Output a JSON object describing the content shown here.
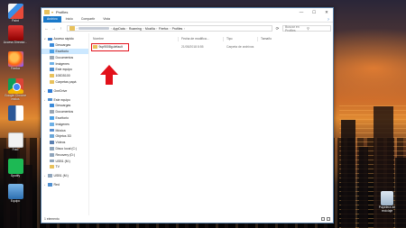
{
  "desktop": {
    "icons": [
      {
        "label": "Paint",
        "icon": "paint-icon"
      },
      {
        "label": "Access Director...",
        "icon": "access-icon"
      },
      {
        "label": "Firefox",
        "icon": "firefox-icon"
      },
      {
        "label": "Google Chrome realos",
        "icon": "chrome-icon"
      },
      {
        "label": "",
        "icon": "word-icon"
      },
      {
        "label": "Foto",
        "icon": "document-icon"
      },
      {
        "label": "Foto pagina",
        "icon": "document-icon"
      },
      {
        "label": "Spotify",
        "icon": "spotify-icon"
      },
      {
        "label": "Equipo",
        "icon": "this-pc-icon"
      },
      {
        "label": "Dispositivo",
        "icon": "device-icon"
      },
      {
        "label": "Papelera de reciclaje",
        "icon": "recycle-bin-icon"
      }
    ]
  },
  "window": {
    "title": "Profiles",
    "ribbon_tabs": [
      "Archivo",
      "Inicio",
      "Compartir",
      "Vista"
    ],
    "address": {
      "crumbs": [
        "AppData",
        "Roaming",
        "Mozilla",
        "Firefox",
        "Profiles"
      ]
    },
    "search_placeholder": "Buscar en Profiles",
    "nav": {
      "quick_access": "Acceso rápido",
      "items": [
        {
          "label": "Descargas",
          "color": "#3b8ad9",
          "level": 2
        },
        {
          "label": "Escritorio",
          "color": "#4aa0e6",
          "level": 2,
          "selected": true
        },
        {
          "label": "Documentos",
          "color": "#9aa6b3",
          "level": 2
        },
        {
          "label": "Imágenes",
          "color": "#6db0e6",
          "level": 2
        },
        {
          "label": "Este equipo",
          "color": "#4f8fd0",
          "level": 2
        },
        {
          "label": "100D5100",
          "color": "#e8c15b",
          "level": 2
        },
        {
          "label": "Carpetas papá",
          "color": "#e8c15b",
          "level": 2
        },
        {
          "label": "OneDrive",
          "color": "#2e7bd6",
          "level": 1,
          "gap": true
        },
        {
          "label": "Este equipo",
          "color": "#4f8fd0",
          "level": 1,
          "gap": true
        },
        {
          "label": "Descargas",
          "color": "#3b8ad9",
          "level": 2
        },
        {
          "label": "Documentos",
          "color": "#9aa6b3",
          "level": 2
        },
        {
          "label": "Escritorio",
          "color": "#4aa0e6",
          "level": 2
        },
        {
          "label": "Imágenes",
          "color": "#6db0e6",
          "level": 2
        },
        {
          "label": "Música",
          "color": "#5a8fd0",
          "level": 2
        },
        {
          "label": "Objetos 3D",
          "color": "#6aa6d8",
          "level": 2
        },
        {
          "label": "Vídeos",
          "color": "#5b7fb0",
          "level": 2
        },
        {
          "label": "Disco local (C:)",
          "color": "#8ea4bb",
          "level": 2
        },
        {
          "label": "Recovery (D:)",
          "color": "#8ea4bb",
          "level": 2
        },
        {
          "label": "USB1 (M:)",
          "color": "#8ea4bb",
          "level": 2
        },
        {
          "label": "TV",
          "color": "#e8c15b",
          "level": 2
        },
        {
          "label": "USB1 (M:)",
          "color": "#8ea4bb",
          "level": 1,
          "gap": true
        },
        {
          "label": "Red",
          "color": "#4f8fd0",
          "level": 1,
          "gap": true
        }
      ]
    },
    "columns": {
      "name": "Nombre",
      "date": "Fecha de modifica...",
      "type": "Tipo",
      "size": "Tamaño"
    },
    "files": [
      {
        "name": "9up9008g.default",
        "date": "21/05/2018 8:55",
        "type": "Carpeta de archivos"
      }
    ],
    "status": "1 elemento",
    "accent": "#e2101a"
  }
}
